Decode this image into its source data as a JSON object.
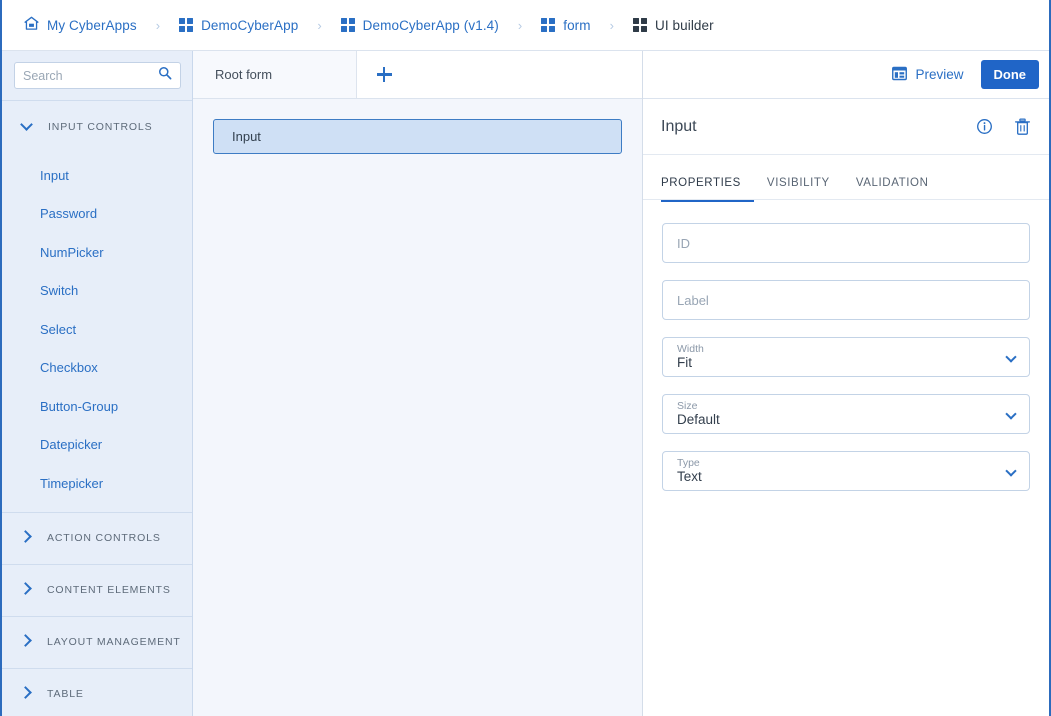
{
  "breadcrumb": [
    {
      "label": "My CyberApps",
      "icon": "home-icon",
      "current": false
    },
    {
      "label": "DemoCyberApp",
      "icon": "grid-icon",
      "current": false
    },
    {
      "label": "DemoCyberApp (v1.4)",
      "icon": "grid-icon",
      "current": false
    },
    {
      "label": "form",
      "icon": "grid-icon",
      "current": false
    },
    {
      "label": "UI builder",
      "icon": "grid-icon",
      "current": true
    }
  ],
  "breadcrumb_separator": "›",
  "sidebar": {
    "search": {
      "value": "",
      "placeholder": "Search",
      "icon": "search-icon"
    },
    "groups": [
      {
        "title": "INPUT CONTROLS",
        "expanded": true,
        "items": [
          "Input",
          "Password",
          "NumPicker",
          "Switch",
          "Select",
          "Checkbox",
          "Button-Group",
          "Datepicker",
          "Timepicker"
        ]
      },
      {
        "title": "ACTION CONTROLS",
        "expanded": false,
        "items": []
      },
      {
        "title": "CONTENT ELEMENTS",
        "expanded": false,
        "items": []
      },
      {
        "title": "LAYOUT MANAGEMENT",
        "expanded": false,
        "items": []
      },
      {
        "title": "TABLE",
        "expanded": false,
        "items": []
      }
    ]
  },
  "canvas": {
    "tabs": [
      {
        "label": "Root form",
        "active": true
      }
    ],
    "add_tab_icon": "plus-icon",
    "widgets": [
      {
        "label": "Input",
        "selected": true
      }
    ]
  },
  "rightpanel": {
    "toolbar": {
      "preview_label": "Preview",
      "preview_icon": "layout-icon",
      "done_label": "Done"
    },
    "header": {
      "title": "Input",
      "info_icon": "info-icon",
      "delete_icon": "trash-icon"
    },
    "tabs": [
      {
        "label": "PROPERTIES",
        "active": true
      },
      {
        "label": "VISIBILITY",
        "active": false
      },
      {
        "label": "VALIDATION",
        "active": false
      }
    ],
    "fields": [
      {
        "kind": "text",
        "placeholder": "ID",
        "value": ""
      },
      {
        "kind": "text",
        "placeholder": "Label",
        "value": ""
      },
      {
        "kind": "select",
        "label": "Width",
        "value": "Fit"
      },
      {
        "kind": "select",
        "label": "Size",
        "value": "Default"
      },
      {
        "kind": "select",
        "label": "Type",
        "value": "Text"
      }
    ]
  },
  "colors": {
    "accent": "#2a6fc4",
    "button_blue": "#2065c7",
    "sidebar_bg": "#e7eef9",
    "canvas_bg": "#f3f6fc",
    "selected_widget_bg": "#cfe0f5",
    "selected_widget_border": "#3d7cc4"
  }
}
